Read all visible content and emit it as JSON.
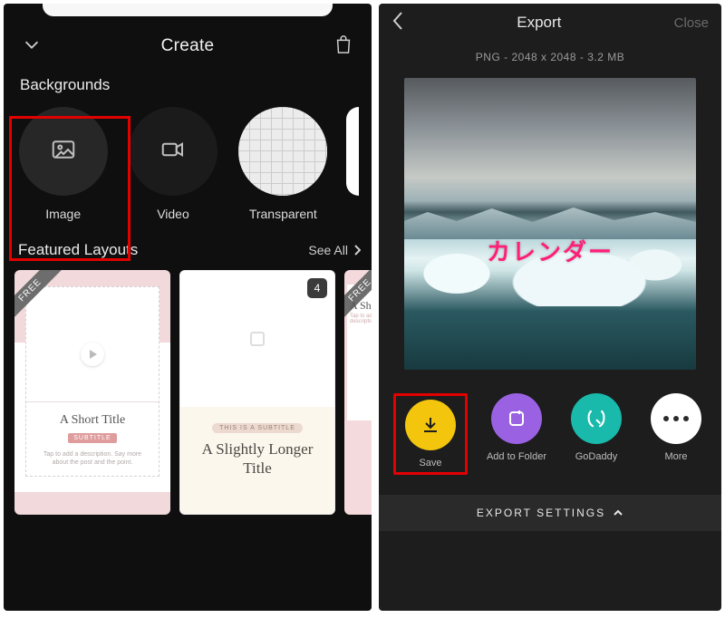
{
  "left": {
    "header": {
      "title": "Create"
    },
    "sections": {
      "backgrounds": {
        "label": "Backgrounds",
        "items": [
          "Image",
          "Video",
          "Transparent"
        ]
      },
      "featured": {
        "label": "Featured Layouts",
        "see_all": "See All"
      }
    },
    "layouts": {
      "card1": {
        "sash": "FREE",
        "title": "A Short Title",
        "badge": "SUBTITLE",
        "desc": "Tap to add a description. Say more about the post and the point."
      },
      "card2": {
        "count": "4",
        "pill": "THIS IS A SUBTITLE",
        "title": "A Slightly Longer Title"
      },
      "card3": {
        "sash": "FREE",
        "title": "A Shor",
        "desc": "Tap to add a description."
      }
    }
  },
  "right": {
    "header": {
      "title": "Export",
      "close": "Close"
    },
    "meta": "PNG - 2048 x 2048 - 3.2 MB",
    "preview": {
      "text": "カレンダー"
    },
    "actions": {
      "save": "Save",
      "folder": "Add to Folder",
      "godaddy": "GoDaddy",
      "more": "More"
    },
    "export_settings": "EXPORT SETTINGS"
  }
}
